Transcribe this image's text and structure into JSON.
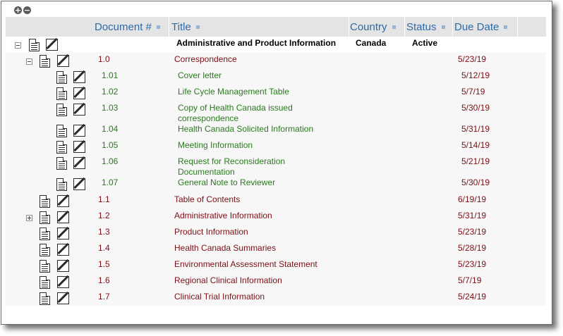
{
  "controls": {
    "expand_all": "+",
    "collapse_all": "−"
  },
  "columns": {
    "doc_num": "Document #",
    "title": "Title",
    "country": "Country",
    "status": "Status",
    "due_date": "Due Date"
  },
  "root": {
    "title": "Administrative and Product Information",
    "country": "Canada",
    "status": "Active"
  },
  "section": {
    "num": "1.0",
    "title": "Correspondence",
    "due": "5/23/19"
  },
  "children": [
    {
      "num": "1.01",
      "title": "Cover letter",
      "title2": "",
      "due": "5/12/19"
    },
    {
      "num": "1.02",
      "title": "Life Cycle Management Table",
      "title2": "",
      "due": "5/7/19"
    },
    {
      "num": "1.03",
      "title": "Copy of Health Canada issued",
      "title2": "correspondence",
      "due": "5/30/19"
    },
    {
      "num": "1.04",
      "title": "Health Canada Solicited Information",
      "title2": "",
      "due": "5/31/19"
    },
    {
      "num": "1.05",
      "title": "Meeting Information",
      "title2": "",
      "due": "5/14/19"
    },
    {
      "num": "1.06",
      "title": "Request for Reconsideration",
      "title2": "Documentation",
      "due": "5/21/19"
    },
    {
      "num": "1.07",
      "title": "General Note to Reviewer",
      "title2": "",
      "due": "5/30/19"
    }
  ],
  "sections": [
    {
      "num": "1.1",
      "title": "Table of Contents",
      "due": "6/19/19"
    },
    {
      "num": "1.2",
      "title": "Administrative Information",
      "due": "5/31/19"
    },
    {
      "num": "1.3",
      "title": "Product Information",
      "due": "5/23/19"
    },
    {
      "num": "1.4",
      "title": "Health Canada Summaries",
      "due": "5/28/19"
    },
    {
      "num": "1.5",
      "title": "Environmental Assessment Statement",
      "due": "5/23/19"
    },
    {
      "num": "1.6",
      "title": "Regional Clinical Information",
      "due": "5/7/19"
    },
    {
      "num": "1.7",
      "title": "Clinical Trial Information",
      "due": "5/24/19"
    }
  ]
}
